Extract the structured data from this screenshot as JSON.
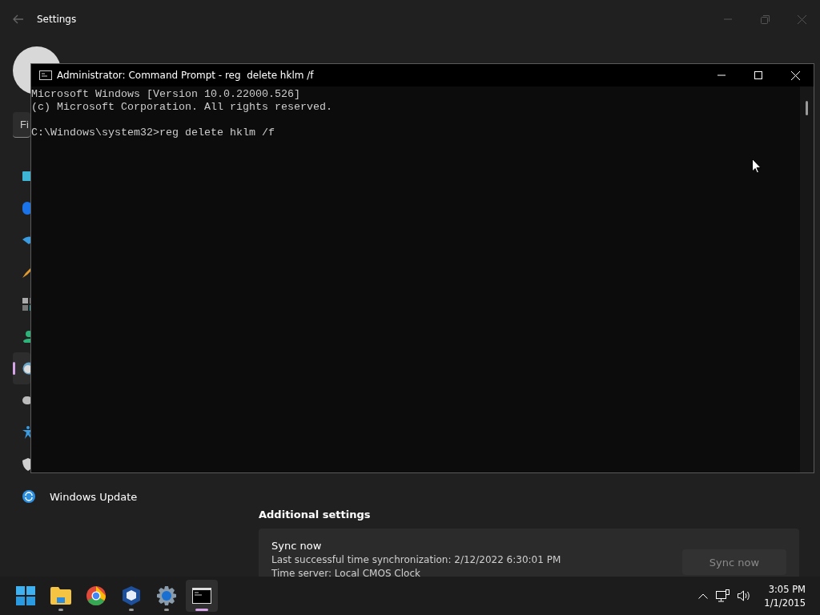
{
  "settings_window": {
    "title": "Settings",
    "search": {
      "placeholder": "Fi"
    },
    "sidebar": {
      "items": [
        {
          "selected": false
        },
        {
          "selected": false
        },
        {
          "selected": false
        },
        {
          "selected": false
        },
        {
          "selected": false
        },
        {
          "selected": false
        },
        {
          "selected": true
        },
        {
          "selected": false
        },
        {
          "selected": false
        },
        {
          "selected": false
        },
        {
          "selected": false,
          "label": "Windows Update"
        }
      ]
    },
    "section": {
      "heading": "Additional settings",
      "card": {
        "title": "Sync now",
        "lines": [
          "Last successful time synchronization: 2/12/2022 6:30:01 PM",
          "Time server: Local CMOS Clock"
        ],
        "button": {
          "label": "Sync now",
          "disabled": true
        }
      }
    }
  },
  "cmd_window": {
    "title": "Administrator: Command Prompt - reg  delete hklm /f",
    "output": [
      "Microsoft Windows [Version 10.0.22000.526]",
      "(c) Microsoft Corporation. All rights reserved."
    ],
    "prompt": "C:\\Windows\\system32>reg delete hklm /f"
  },
  "taskbar": {
    "apps": [
      {
        "running": false,
        "selected": false
      },
      {
        "running": true,
        "selected": false
      },
      {
        "running": false,
        "selected": false
      },
      {
        "running": true,
        "selected": false
      },
      {
        "running": true,
        "selected": false
      },
      {
        "running": true,
        "selected": true
      }
    ],
    "clock": {
      "time": "3:05 PM",
      "date": "1/1/2015"
    }
  }
}
